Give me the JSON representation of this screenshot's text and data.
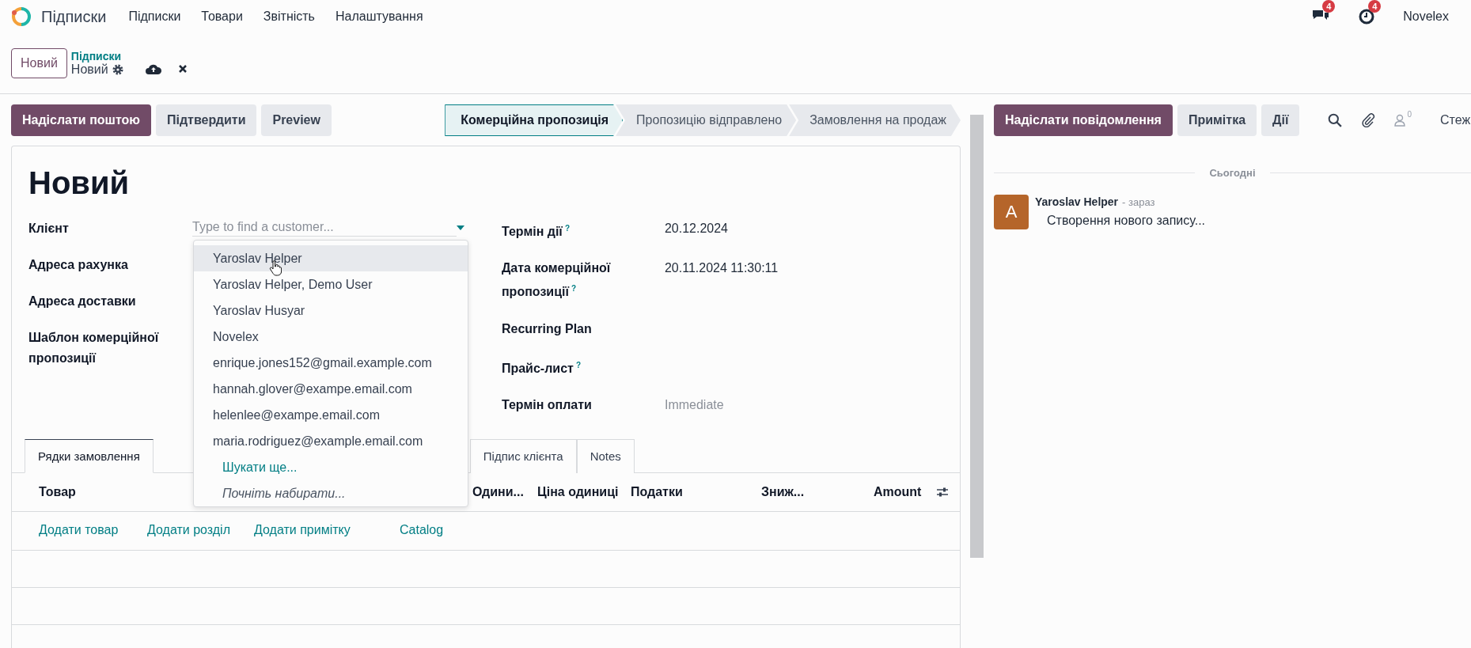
{
  "navbar": {
    "app_name": "Підписки",
    "menu": [
      "Підписки",
      "Товари",
      "Звітність",
      "Налаштування"
    ],
    "messages_badge": "4",
    "activities_badge": "4",
    "company": "Novelex"
  },
  "control_panel": {
    "new_button": "Новий",
    "breadcrumb_parent": "Підписки",
    "breadcrumb_current": "Новий"
  },
  "actions": [
    {
      "label": "Надіслати поштою",
      "kind": "primary"
    },
    {
      "label": "Підтвердити",
      "kind": "secondary"
    },
    {
      "label": "Preview",
      "kind": "secondary"
    }
  ],
  "status_bar": [
    {
      "label": "Комерційна пропозиція",
      "selected": true
    },
    {
      "label": "Пропозицію відправлено",
      "selected": false
    },
    {
      "label": "Замовлення на продаж",
      "selected": false
    }
  ],
  "form": {
    "title": "Новий",
    "left_fields": [
      {
        "label": "Клієнт",
        "placeholder": "Type to find a customer..."
      },
      {
        "label": "Адреса рахунка"
      },
      {
        "label": "Адреса доставки"
      },
      {
        "label": "Шаблон комерційної пропозиції"
      }
    ],
    "right_fields": [
      {
        "label": "Термін дії",
        "help": "?",
        "value": "20.12.2024"
      },
      {
        "label": "Дата комерційної пропозиції",
        "help": "?",
        "value": "20.11.2024 11:30:11"
      },
      {
        "label": "Recurring Plan"
      },
      {
        "label": "Прайс-лист",
        "help": "?"
      },
      {
        "label": "Термін оплати",
        "placeholder": "Immediate"
      }
    ],
    "tabs": [
      {
        "label": "Рядки замовлення",
        "selected": true
      },
      {
        "label": "Підпис клієнта",
        "selected": false
      },
      {
        "label": "Notes",
        "selected": false
      }
    ],
    "table": {
      "columns": [
        "Товар",
        "Одини...",
        "Ціна одиниці",
        "Податки",
        "Зниж...",
        "Amount"
      ],
      "add_links": [
        "Додати товар",
        "Додати розділ",
        "Додати примітку",
        "Catalog"
      ]
    }
  },
  "dropdown": {
    "items": [
      {
        "label": "Yaroslav Helper",
        "selected": true
      },
      {
        "label": "Yaroslav Helper, Demo User",
        "selected": false
      },
      {
        "label": "Yaroslav Husyar",
        "selected": false
      },
      {
        "label": "Novelex",
        "selected": false
      },
      {
        "label": "enrique.jones152@gmail.example.com",
        "selected": false
      },
      {
        "label": "hannah.glover@exampe.email.com",
        "selected": false
      },
      {
        "label": "helenlee@exampe.email.com",
        "selected": false
      },
      {
        "label": "maria.rodriguez@example.email.com",
        "selected": false
      }
    ],
    "search_more": "Шукати ще...",
    "hint": "Почніть набирати..."
  },
  "chatter": {
    "buttons": [
      {
        "label": "Надіслати повідомлення",
        "kind": "primary"
      },
      {
        "label": "Примітка",
        "kind": "secondary"
      },
      {
        "label": "Дії",
        "kind": "secondary"
      }
    ],
    "followers_count": "0",
    "follow": "Стеж",
    "date_separator": "Сьогодні",
    "messages": [
      {
        "avatar": "A",
        "author": "Yaroslav Helper",
        "time": "- зараз",
        "body": "Створення нового запису..."
      }
    ]
  }
}
